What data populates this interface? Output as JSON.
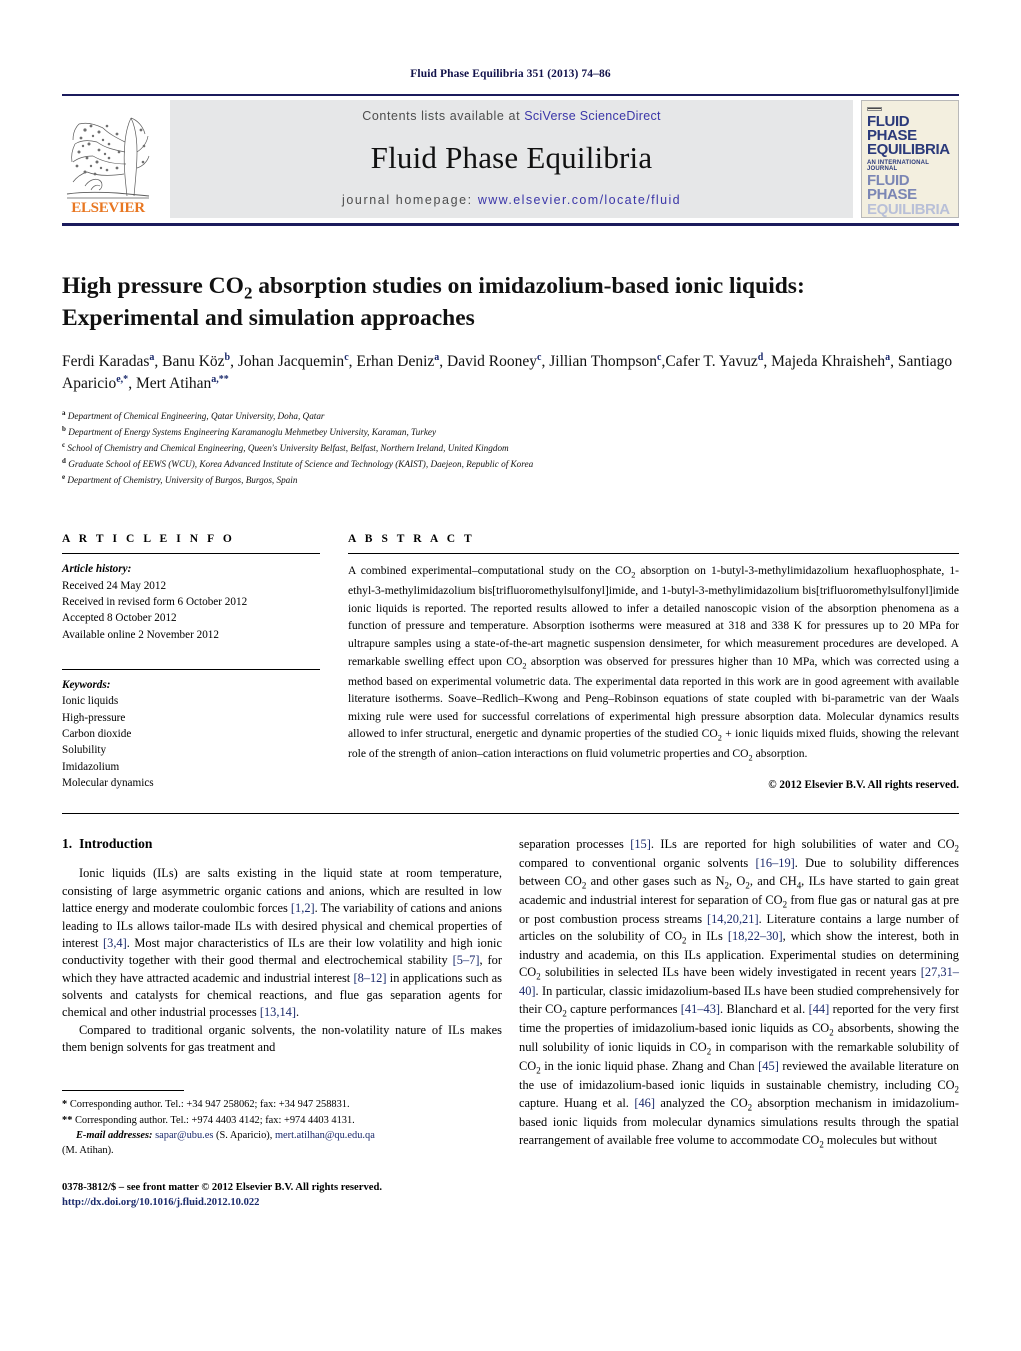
{
  "running_head": "Fluid Phase Equilibria 351 (2013) 74–86",
  "masthead": {
    "publisher_name": "ELSEVIER",
    "contents_prefix": "Contents lists available at ",
    "contents_link": "SciVerse ScienceDirect",
    "journal_title": "Fluid Phase Equilibria",
    "homepage_prefix": "journal homepage: ",
    "homepage_url": "www.elsevier.com/locate/fluid",
    "cover": {
      "line1": "FLUID PHASE",
      "line2": "EQUILIBRIA",
      "subtitle": "AN INTERNATIONAL JOURNAL",
      "line3": "FLUID PHASE",
      "line4": "EQUILIBRIA"
    }
  },
  "article": {
    "title_line1": "High pressure CO",
    "title_sub1": "2",
    "title_line1b": " absorption studies on imidazolium-based ionic liquids:",
    "title_line2": "Experimental and simulation approaches",
    "authors": [
      {
        "name": "Ferdi Karadas",
        "sup": "a",
        "sep": ", "
      },
      {
        "name": "Banu Köz",
        "sup": "b",
        "sep": ", "
      },
      {
        "name": "Johan Jacquemin",
        "sup": "c",
        "sep": ", "
      },
      {
        "name": "Erhan Deniz",
        "sup": "a",
        "sep": ", "
      },
      {
        "name": "David Rooney",
        "sup": "c",
        "sep": ", "
      },
      {
        "name": "Jillian Thompson",
        "sup": "c",
        "sep": ","
      },
      {
        "name": "Cafer T. Yavuz",
        "sup": "d",
        "sep": ", "
      },
      {
        "name": "Majeda Khraisheh",
        "sup": "a",
        "sep": ", "
      },
      {
        "name": "Santiago Aparicio",
        "sup": "e,*",
        "sep": ", "
      },
      {
        "name": "Mert Atihan",
        "sup": "a,**",
        "sep": ""
      }
    ],
    "affiliations": [
      {
        "mark": "a",
        "text": "Department of Chemical Engineering, Qatar University, Doha, Qatar"
      },
      {
        "mark": "b",
        "text": "Department of Energy Systems Engineering Karamanoglu Mehmetbey University, Karaman, Turkey"
      },
      {
        "mark": "c",
        "text": "School of Chemistry and Chemical Engineering, Queen's University Belfast, Belfast, Northern Ireland, United Kingdom"
      },
      {
        "mark": "d",
        "text": "Graduate School of EEWS (WCU), Korea Advanced Institute of Science and Technology (KAIST), Daejeon, Republic of Korea"
      },
      {
        "mark": "e",
        "text": "Department of Chemistry, University of Burgos, Burgos, Spain"
      }
    ]
  },
  "info": {
    "heading": "A R T I C L E    I N F O",
    "history_label": "Article history:",
    "history": [
      "Received 24 May 2012",
      "Received in revised form 6 October 2012",
      "Accepted 8 October 2012",
      "Available online 2 November 2012"
    ],
    "keywords_label": "Keywords:",
    "keywords": [
      "Ionic liquids",
      "High-pressure",
      "Carbon dioxide",
      "Solubility",
      "Imidazolium",
      "Molecular dynamics"
    ]
  },
  "abstract": {
    "heading": "A B S T R A C T",
    "text": "A combined experimental–computational study on the CO2 absorption on 1-butyl-3-methylimidazolium hexafluophosphate, 1-ethyl-3-methylimidazolium bis[trifluoromethylsulfonyl]imide, and 1-butyl-3-methylimidazolium bis[trifluoromethylsulfonyl]imide ionic liquids is reported. The reported results allowed to infer a detailed nanoscopic vision of the absorption phenomena as a function of pressure and temperature. Absorption isotherms were measured at 318 and 338 K for pressures up to 20 MPa for ultrapure samples using a state-of-the-art magnetic suspension densimeter, for which measurement procedures are developed. A remarkable swelling effect upon CO2 absorption was observed for pressures higher than 10 MPa, which was corrected using a method based on experimental volumetric data. The experimental data reported in this work are in good agreement with available literature isotherms. Soave–Redlich–Kwong and Peng–Robinson equations of state coupled with bi-parametric van der Waals mixing rule were used for successful correlations of experimental high pressure absorption data. Molecular dynamics results allowed to infer structural, energetic and dynamic properties of the studied CO2 + ionic liquids mixed fluids, showing the relevant role of the strength of anion–cation interactions on fluid volumetric properties and CO2 absorption.",
    "copyright": "© 2012 Elsevier B.V. All rights reserved."
  },
  "introduction": {
    "number": "1.",
    "title": "Introduction",
    "left_paragraph_1": "Ionic liquids (ILs) are salts existing in the liquid state at room temperature, consisting of large asymmetric organic cations and anions, which are resulted in low lattice energy and moderate coulombic forces [1,2]. The variability of cations and anions leading to ILs allows tailor-made ILs with desired physical and chemical properties of interest [3,4]. Most major characteristics of ILs are their low volatility and high ionic conductivity together with their good thermal and electrochemical stability [5–7], for which they have attracted academic and industrial interest [8–12] in applications such as solvents and catalysts for chemical reactions, and flue gas separation agents for chemical and other industrial processes [13,14].",
    "left_paragraph_2": "Compared to traditional organic solvents, the non-volatility nature of ILs makes them benign solvents for gas treatment and",
    "right_paragraph_1": "separation processes [15]. ILs are reported for high solubilities of water and CO2 compared to conventional organic solvents [16–19]. Due to solubility differences between CO2 and other gases such as N2, O2, and CH4, ILs have started to gain great academic and industrial interest for separation of CO2 from flue gas or natural gas at pre or post combustion process streams [14,20,21]. Literature contains a large number of articles on the solubility of CO2 in ILs [18,22–30], which show the interest, both in industry and academia, on this ILs application. Experimental studies on determining CO2 solubilities in selected ILs have been widely investigated in recent years [27,31–40]. In particular, classic imidazolium-based ILs have been studied comprehensively for their CO2 capture performances [41–43]. Blanchard et al. [44] reported for the very first time the properties of imidazolium-based ionic liquids as CO2 absorbents, showing the null solubility of ionic liquids in CO2 in comparison with the remarkable solubility of CO2 in the ionic liquid phase. Zhang and Chan [45] reviewed the available literature on the use of imidazolium-based ionic liquids in sustainable chemistry, including CO2 capture. Huang et al. [46] analyzed the CO2 absorption mechanism in imidazolium-based ionic liquids from molecular dynamics simulations results through the spatial rearrangement of available free volume to accommodate CO2 molecules but without"
  },
  "footnotes": {
    "corresponding_1_mark": "*",
    "corresponding_1": "Corresponding author. Tel.: +34 947 258062; fax: +34 947 258831.",
    "corresponding_2_mark": "**",
    "corresponding_2": "Corresponding author. Tel.: +974 4403 4142; fax: +974 4403 4131.",
    "email_label": "E-mail addresses:",
    "email_1": "sapar@ubu.es",
    "email_1_owner": "(S. Aparicio),",
    "email_2": "mert.atilhan@qu.edu.qa",
    "email_2_owner": "(M. Atihan).",
    "front_matter": "0378-3812/$ – see front matter © 2012 Elsevier B.V. All rights reserved.",
    "doi": "http://dx.doi.org/10.1016/j.fluid.2012.10.022"
  }
}
